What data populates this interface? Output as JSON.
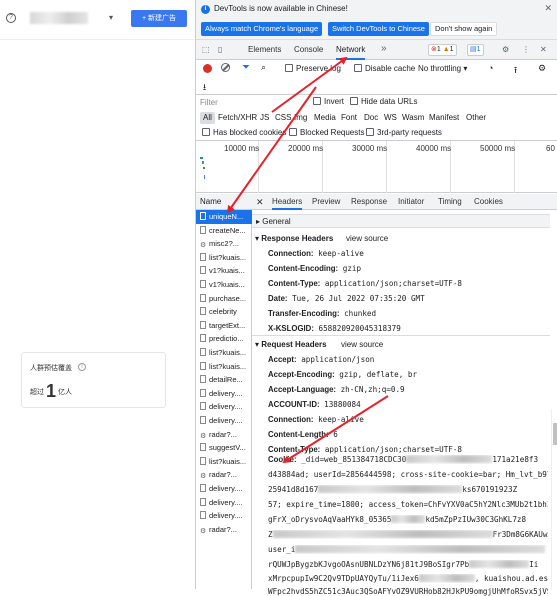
{
  "page": {
    "help_icon": "question-circle-icon",
    "account_chevron": "▾",
    "new_ad_button": "+ 新建广告",
    "audience_card": {
      "title": "人群预估覆盖",
      "prefix": "超过",
      "value": "1",
      "unit": "亿人"
    }
  },
  "devtools": {
    "banner": {
      "message": "DevTools is now available in Chinese!",
      "match_button": "Always match Chrome's language",
      "switch_button": "Switch DevTools to Chinese",
      "dismiss_button": "Don't show again",
      "close": "✕"
    },
    "tabs": [
      "Elements",
      "Console",
      "Network"
    ],
    "active_tab": "Network",
    "more_tabs": "»",
    "errors": "1",
    "warnings": "1",
    "messages": "1",
    "toolbar": {
      "preserve_log": "Preserve log",
      "disable_cache": "Disable cache",
      "throttling": "No throttling"
    },
    "filter": {
      "placeholder": "Filter",
      "invert": "Invert",
      "hide_data_urls": "Hide data URLs",
      "types": [
        "All",
        "Fetch/XHR",
        "JS",
        "CSS",
        "Img",
        "Media",
        "Font",
        "Doc",
        "WS",
        "Wasm",
        "Manifest",
        "Other"
      ],
      "has_blocked_cookies": "Has blocked cookies",
      "blocked_requests": "Blocked Requests",
      "third_party": "3rd-party requests"
    },
    "timeline_ticks": [
      "10000 ms",
      "20000 ms",
      "30000 ms",
      "40000 ms",
      "50000 ms",
      "60"
    ],
    "requests_header": "Name",
    "requests": [
      "uniqueN...",
      "createNe...",
      "misc2?...",
      "list?kuais...",
      "v1?kuais...",
      "v1?kuais...",
      "purchase...",
      "celebrity",
      "targetExt...",
      "predictio...",
      "list?kuais...",
      "list?kuais...",
      "detailRe...",
      "delivery....",
      "delivery....",
      "delivery....",
      "radar?...",
      "suggestV...",
      "list?kuais...",
      "radar?...",
      "delivery....",
      "delivery....",
      "delivery....",
      "radar?..."
    ],
    "detail_tabs": [
      "Headers",
      "Preview",
      "Response",
      "Initiator",
      "Timing",
      "Cookies"
    ],
    "detail_close": "✕",
    "general": "General",
    "response_headers_title": "Response Headers",
    "view_source": "view source",
    "response_headers": [
      {
        "k": "Connection:",
        "v": "keep-alive"
      },
      {
        "k": "Content-Encoding:",
        "v": "gzip"
      },
      {
        "k": "Content-Type:",
        "v": "application/json;charset=UTF-8"
      },
      {
        "k": "Date:",
        "v": "Tue, 26 Jul 2022 07:35:20 GMT"
      },
      {
        "k": "Transfer-Encoding:",
        "v": "chunked"
      },
      {
        "k": "X-KSLOGID:",
        "v": "658820920045318379"
      }
    ],
    "request_headers_title": "Request Headers",
    "request_headers": [
      {
        "k": "Accept:",
        "v": "application/json"
      },
      {
        "k": "Accept-Encoding:",
        "v": "gzip, deflate, br"
      },
      {
        "k": "Accept-Language:",
        "v": "zh-CN,zh;q=0.9"
      },
      {
        "k": "ACCOUNT-ID:",
        "v": "13880084"
      },
      {
        "k": "Connection:",
        "v": "keep-alive"
      },
      {
        "k": "Content-Length:",
        "v": "6"
      },
      {
        "k": "Content-Type:",
        "v": "application/json;charset=UTF-8"
      }
    ],
    "cookie_key": "Cookie:",
    "cookie_lines": [
      "_did=web_851384718CDC30",
      "d43884ad; userId=2856444598; cross-site-cookie=bar; Hm_lvt_b9756",
      "25941d8d167",
      "57; expire_time=1800; access_token=ChFvYXV0aC5hY2Nlc3MUb2t1bhIwE",
      "gFrX_oDrysvoAqVaaHYk8_05365",
      "Z",
      "user_i",
      "rQUWJpBygzbKJvgoOAsnUBNLDzYN6j81tJ9BoSIgr7Pb",
      "xMrpcpupIw9C2Qv9TDpUAYQyTu/1iJex6",
      "WFpc2hvdS5hZC51c3Auc3QSoAFYvOZ9VURHob82HJkPU9omgjUhMfoRSvx5jVSXo"
    ],
    "cookie_tails": [
      "171a21e8f3",
      "ks670191923Z",
      "kd5mZpPzIUw30C3GhKL7z8",
      "Fr3Dm8G6KAUwA",
      "Ii",
      ", kuaishou.ad.esp_st"
    ]
  },
  "colors": {
    "accent": "#1a73e8",
    "record": "#d93025",
    "annotation_arrow": "#e8202a",
    "new_ad": "#3a78f2"
  }
}
